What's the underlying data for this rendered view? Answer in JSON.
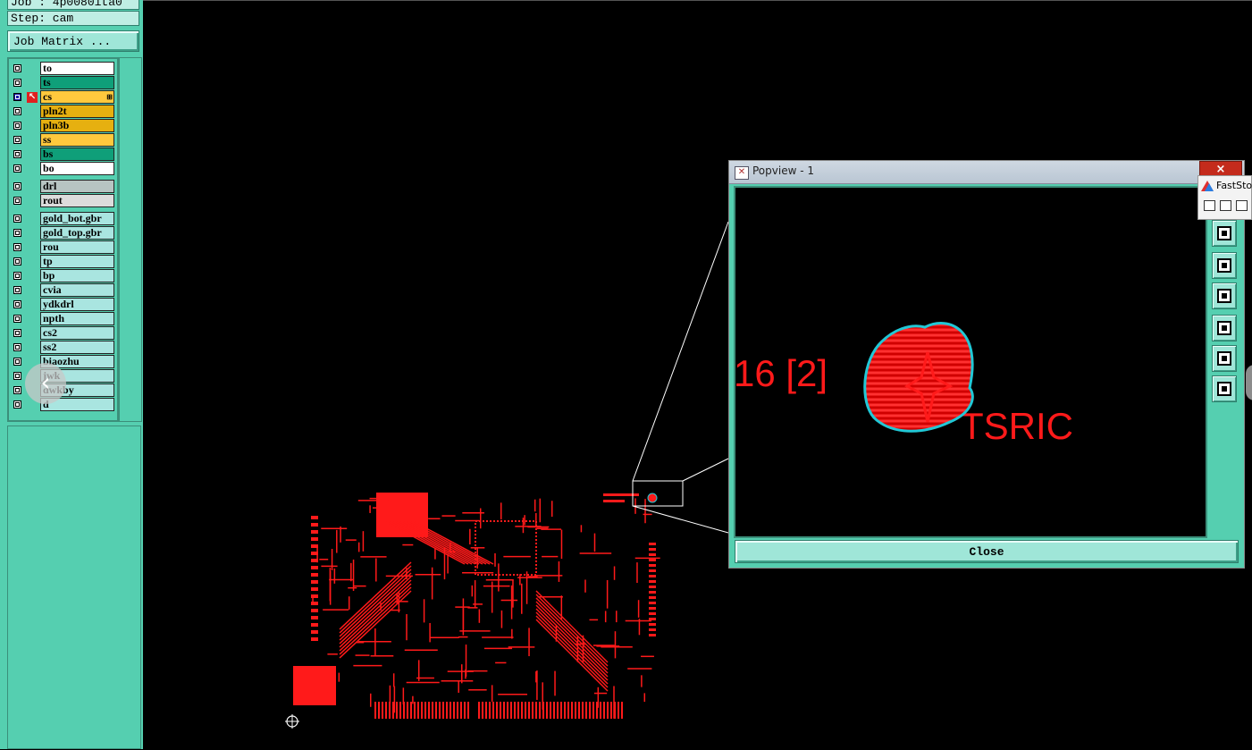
{
  "job_label": "Job : 4p0080ita0",
  "step_label": "Step: cam",
  "job_matrix_button": "Job Matrix ...",
  "layers": [
    {
      "name": "to",
      "color": "#ffffff"
    },
    {
      "name": "ts",
      "color": "#0f9f79"
    },
    {
      "name": "cs",
      "color": "#ffc93d",
      "active": true
    },
    {
      "name": "pln2t",
      "color": "#e6b010"
    },
    {
      "name": "pln3b",
      "color": "#e6b010"
    },
    {
      "name": "ss",
      "color": "#ffc93d"
    },
    {
      "name": "bs",
      "color": "#0f9f79"
    },
    {
      "name": "bo",
      "color": "#ffffff"
    },
    {
      "name": "drl",
      "color": "#b7c4c2"
    },
    {
      "name": "rout",
      "color": "#dcdcdc"
    },
    {
      "name": "gold_bot.gbr",
      "color": "#a9e5e0"
    },
    {
      "name": "gold_top.gbr",
      "color": "#a9e5e0"
    },
    {
      "name": "rou",
      "color": "#a9e5e0"
    },
    {
      "name": "tp",
      "color": "#a9e5e0"
    },
    {
      "name": "bp",
      "color": "#a9e5e0"
    },
    {
      "name": "cvia",
      "color": "#a9e5e0"
    },
    {
      "name": "ydkdrl",
      "color": "#a9e5e0"
    },
    {
      "name": "npth",
      "color": "#a9e5e0"
    },
    {
      "name": "cs2",
      "color": "#a9e5e0"
    },
    {
      "name": "ss2",
      "color": "#a9e5e0"
    },
    {
      "name": "biaozhu",
      "color": "#a9e5e0"
    },
    {
      "name": "jwk",
      "color": "#a9e5e0"
    },
    {
      "name": "dwkby",
      "color": "#a9e5e0"
    },
    {
      "name": "d",
      "color": "#a9e5e0"
    }
  ],
  "popview": {
    "title": "Popview - 1",
    "close_x": "×",
    "zoom_text_left": "16 [2]",
    "zoom_text_right": "TSRIC",
    "close_button": "Close"
  },
  "faststone": {
    "label": "FastStor"
  },
  "colors": {
    "trace": "#ff1a1a",
    "outline": "#21c8d6",
    "panel": "#55cfb0"
  },
  "icons": [
    "arrow-cursor-icon",
    "left-chevron-icon",
    "crosshair-origin-icon",
    "pan-up-icon",
    "pan-down-icon",
    "pan-left-icon",
    "pan-right-icon",
    "zoom-in-icon",
    "zoom-out-icon"
  ]
}
